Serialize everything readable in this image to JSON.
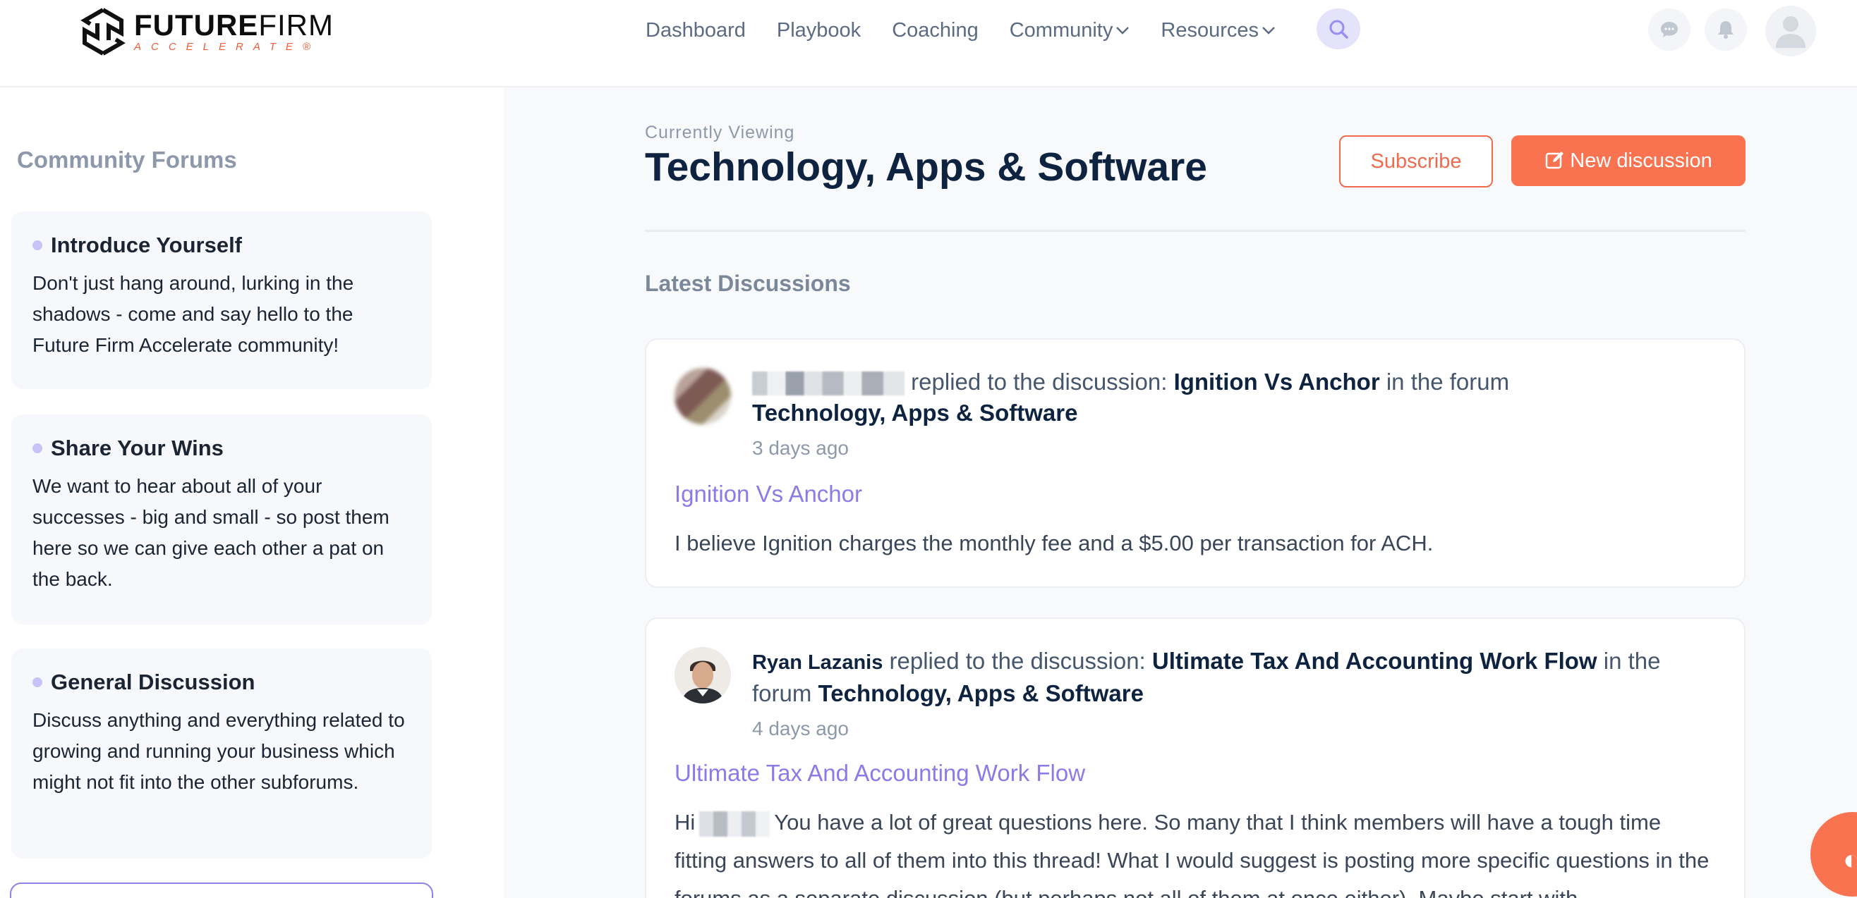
{
  "brand": {
    "name_bold": "FUTURE",
    "name_thin": "FIRM",
    "tagline": "ACCELERATE",
    "registered": "®"
  },
  "nav": {
    "items": [
      {
        "label": "Dashboard"
      },
      {
        "label": "Playbook"
      },
      {
        "label": "Coaching"
      },
      {
        "label": "Community",
        "dropdown": true
      },
      {
        "label": "Resources",
        "dropdown": true
      }
    ]
  },
  "sidebar": {
    "title": "Community Forums",
    "forums": [
      {
        "name": "Introduce Yourself",
        "description": "Don't just hang around, lurking in the shadows - come and say hello to the Future Firm Accelerate community!"
      },
      {
        "name": "Share Your Wins",
        "description": "We want to hear about all of your successes - big and small - so post them here so we can give each other a pat on the back."
      },
      {
        "name": "General Discussion",
        "description": "Discuss anything and everything related to growing and running your business which might not fit into the other subforums."
      }
    ]
  },
  "main": {
    "currently_viewing": "Currently Viewing",
    "title": "Technology, Apps & Software",
    "subscribe_label": "Subscribe",
    "new_discussion_label": "New discussion",
    "section_title": "Latest Discussions",
    "posts": [
      {
        "user": "",
        "action": "replied to the discussion:",
        "discussion": "Ignition Vs Anchor",
        "in_forum_text": "in the forum",
        "forum": "Technology, Apps & Software",
        "time": "3 days ago",
        "title": "Ignition Vs Anchor",
        "body": "I believe Ignition charges the monthly fee and a $5.00 per transaction for ACH."
      },
      {
        "user": "Ryan Lazanis",
        "action": "replied to the discussion:",
        "discussion": "Ultimate Tax And Accounting Work Flow",
        "in_forum_text": "in the forum",
        "forum": "Technology, Apps & Software",
        "time": "4 days ago",
        "title": "Ultimate Tax And Accounting Work Flow",
        "body_prefix": "Hi",
        "body": "You have a lot of great questions here. So many that I think members will have a tough time fitting answers to all of them into this thread! What I would suggest is posting more specific questions in the forums as a separate discussion (but perhaps not all of them at once either). Maybe start with"
      }
    ]
  },
  "colors": {
    "accent": "#f97350",
    "link": "#8b7be8",
    "heading": "#0e2340"
  }
}
